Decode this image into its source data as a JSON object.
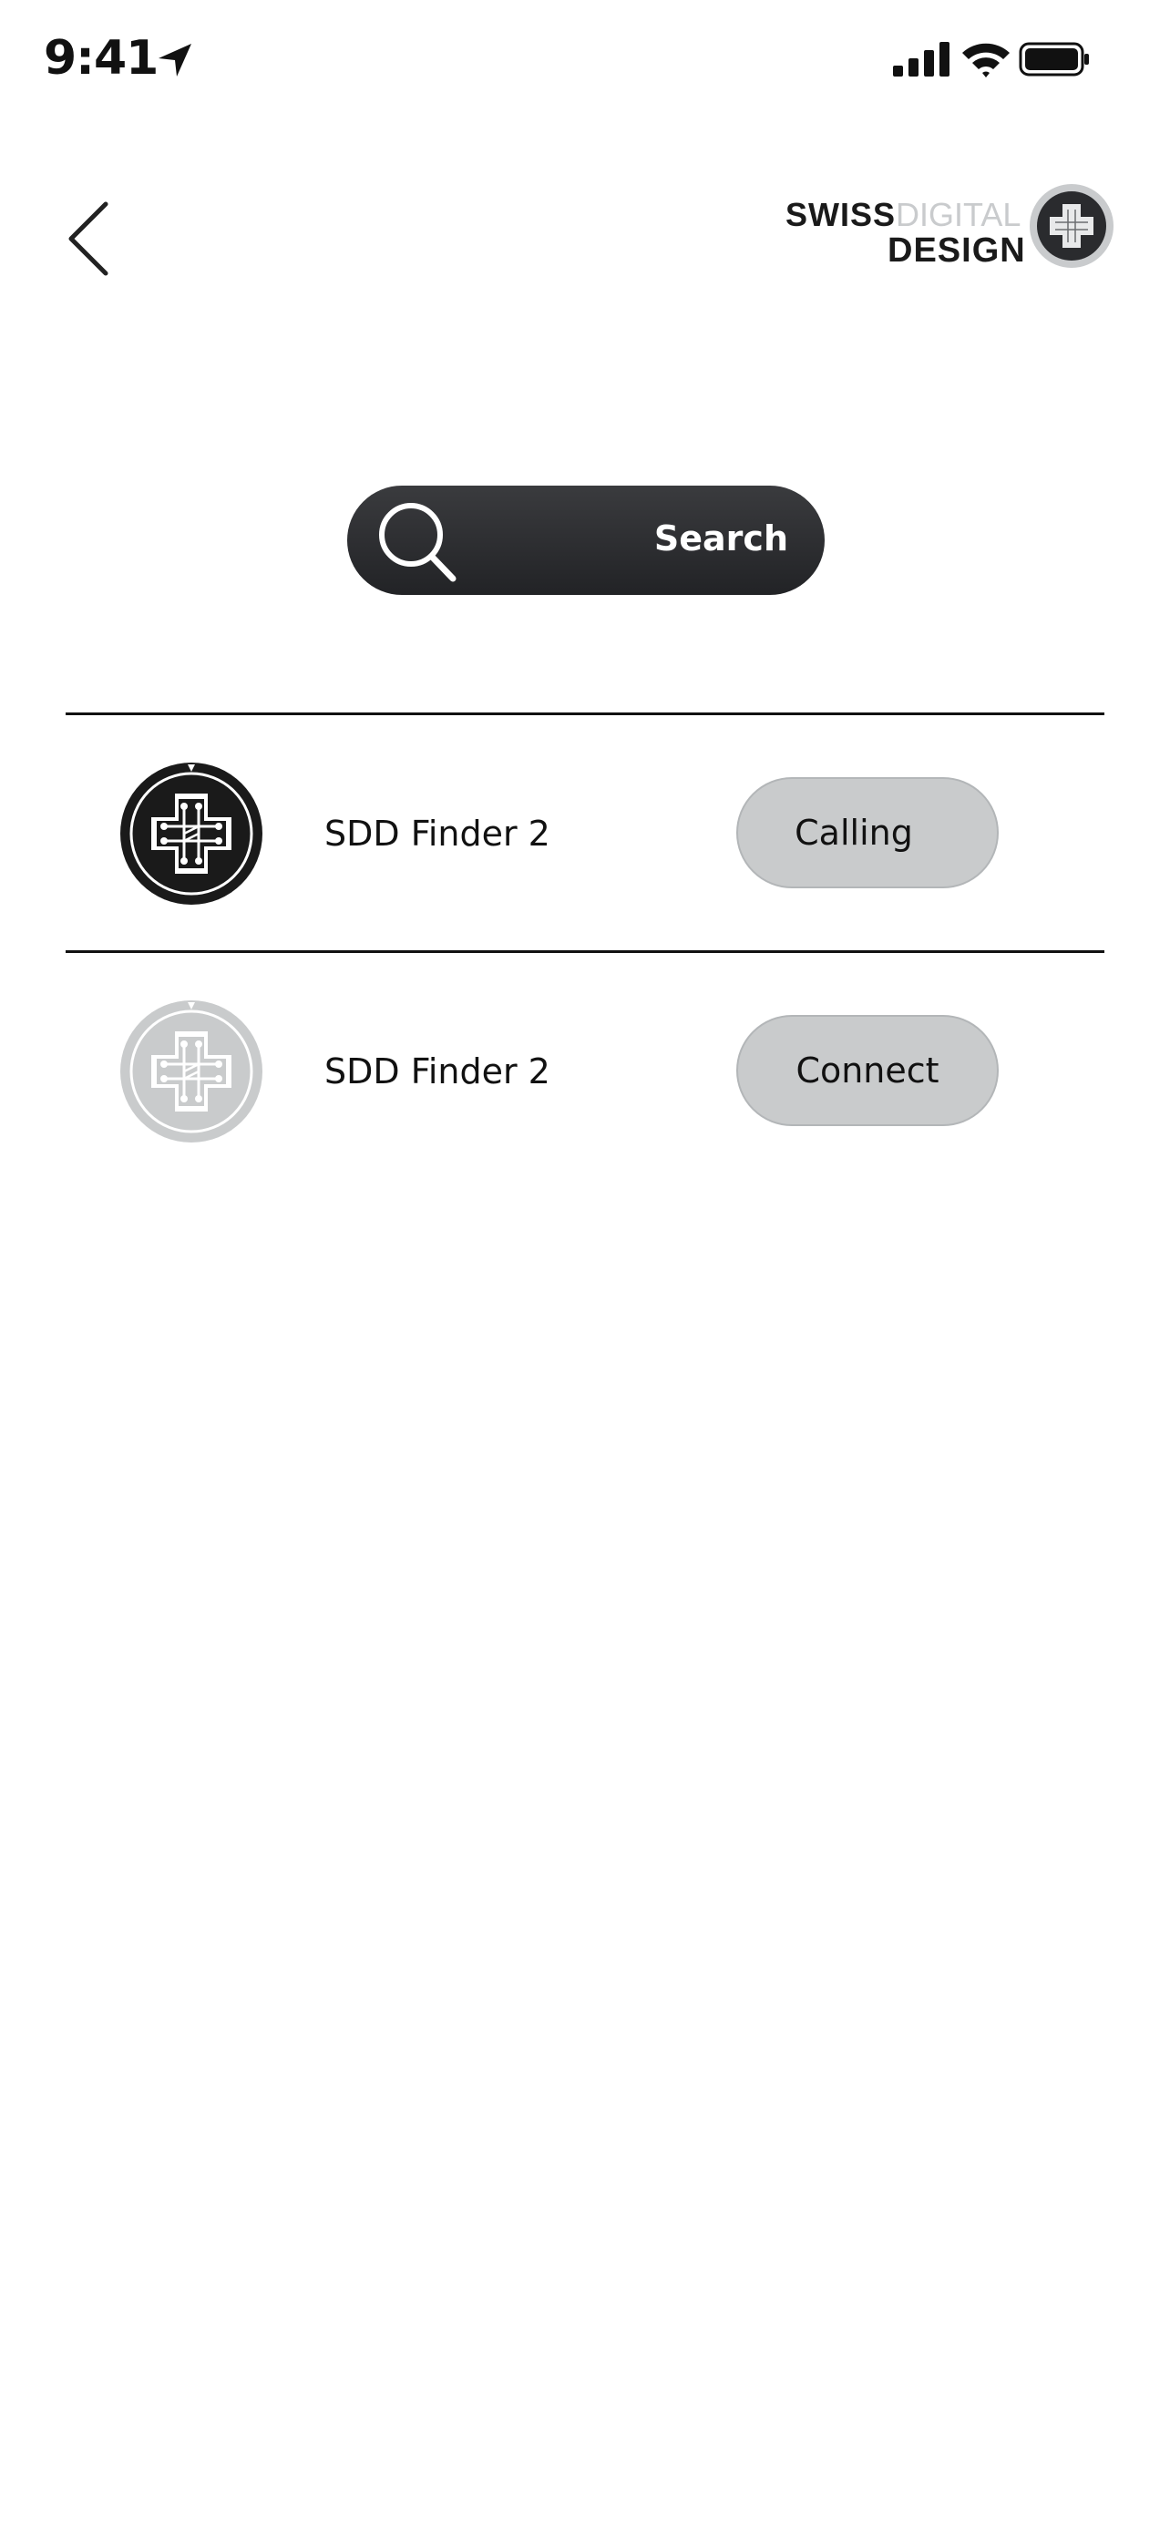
{
  "status_bar": {
    "time": "9:41",
    "icons": [
      "location-arrow-icon",
      "cellular-signal-icon",
      "wifi-icon",
      "battery-icon"
    ]
  },
  "header": {
    "back_icon": "chevron-left-icon",
    "logo": {
      "word_swiss": "SWISS",
      "word_digital": "DIGITAL",
      "word_design": "DESIGN"
    }
  },
  "search": {
    "label": "Search",
    "icon": "search-icon"
  },
  "devices": [
    {
      "name": "SDD Finder 2",
      "action": "Calling",
      "state": "active",
      "icon_color": "#1a1a1a"
    },
    {
      "name": "SDD Finder 2",
      "action": "Connect",
      "state": "inactive",
      "icon_color": "#c9cbcc"
    }
  ],
  "colors": {
    "search_bg": "#2d2e31",
    "button_bg": "#c9cbcc",
    "divider": "#111111",
    "logo_gray": "#c9cbcd"
  }
}
